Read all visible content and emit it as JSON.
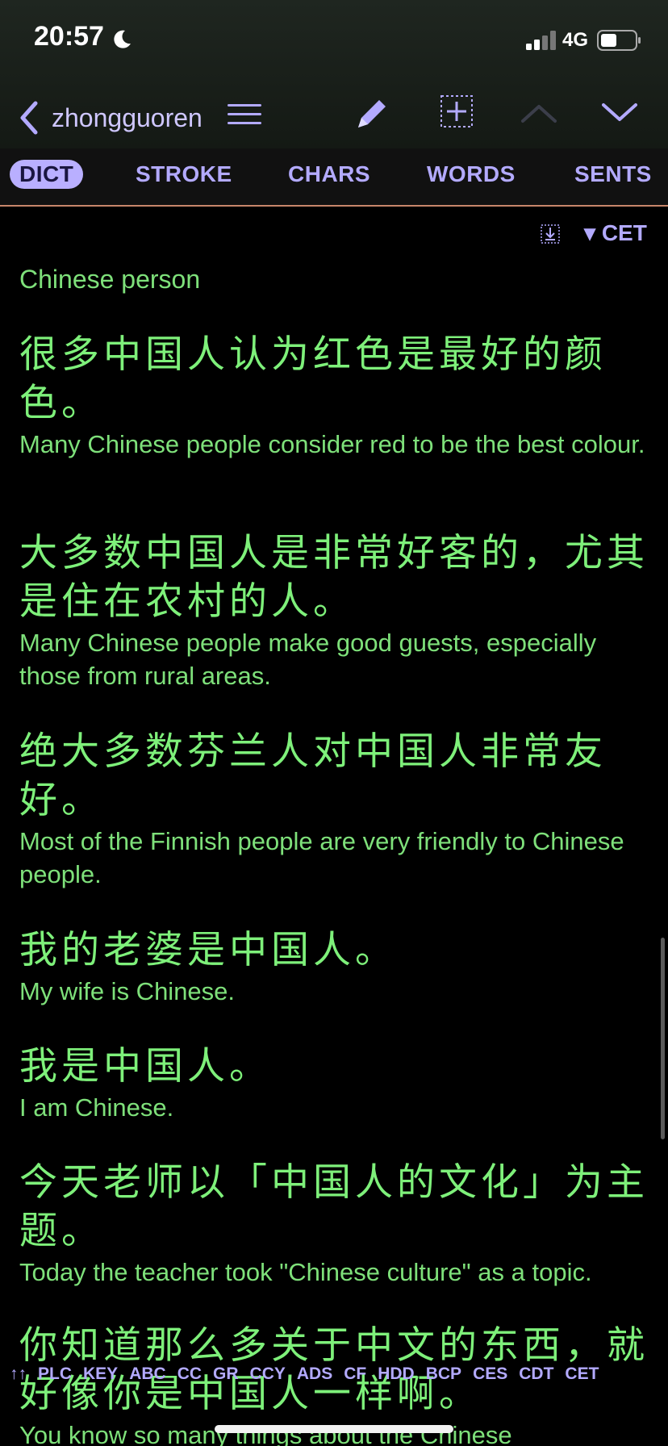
{
  "status_bar": {
    "time": "20:57",
    "network": "4G"
  },
  "nav": {
    "title": "zhongguoren"
  },
  "tabs": [
    {
      "label": "DICT",
      "active": true
    },
    {
      "label": "STROKE",
      "active": false
    },
    {
      "label": "CHARS",
      "active": false
    },
    {
      "label": "WORDS",
      "active": false
    },
    {
      "label": "SENTS",
      "active": false
    }
  ],
  "toolbar": {
    "source_toggle": "▾ CET"
  },
  "entry": {
    "definition": "Chinese person",
    "examples": [
      {
        "zh": "很多中国人认为红色是最好的颜色。",
        "en": "Many Chinese people consider red to be the best colour."
      },
      {
        "zh": "大多数中国人是非常好客的，尤其是住在农村的人。",
        "en": "Many Chinese people make good guests, especially those from rural areas."
      },
      {
        "zh": "绝大多数芬兰人对中国人非常友好。",
        "en": "Most of the Finnish people are very friendly to Chinese people."
      },
      {
        "zh": "我的老婆是中国人。",
        "en": "My wife is Chinese."
      },
      {
        "zh": "我是中国人。",
        "en": "I am Chinese."
      },
      {
        "zh": "今天老师以「中国人的文化」为主题。",
        "en": "Today the teacher took \"Chinese culture\" as a topic."
      },
      {
        "zh": "你知道那么多关于中文的东西，就好像你是中国人一样啊。",
        "en": "You know so many things about the Chinese"
      }
    ]
  },
  "source_strip": {
    "arrows": "↑↑",
    "items": [
      "PLC",
      "KEY",
      "ABC",
      "CC",
      "GR",
      "CCY",
      "ADS",
      "CF",
      "HDD",
      "BCP",
      "CES",
      "CDT",
      "CET"
    ]
  },
  "colors": {
    "accent": "#b3aaff",
    "text_green": "#7ee07a",
    "tab_underline": "#c7866a"
  }
}
